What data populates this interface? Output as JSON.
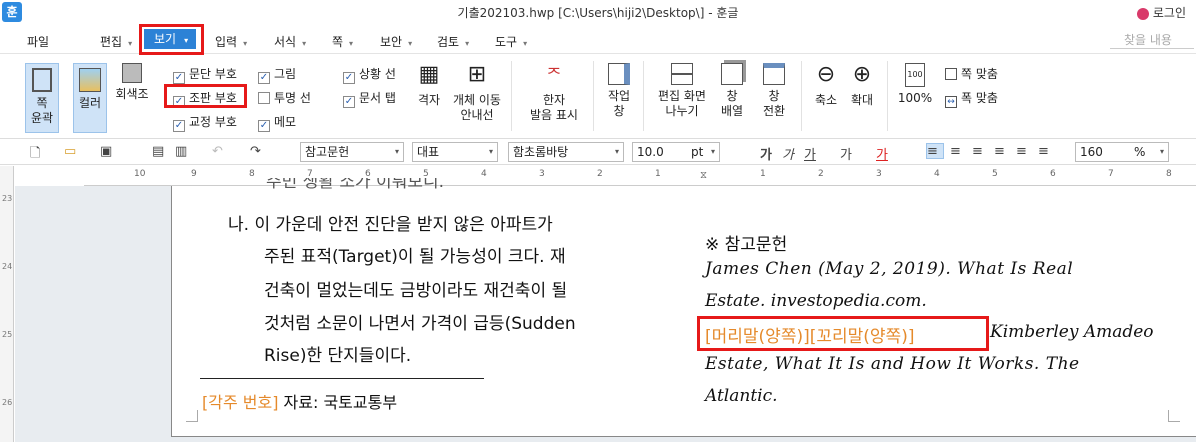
{
  "title": "기출202103.hwp [C:\\Users\\hiji2\\Desktop\\] - 훈글",
  "app_icon": "훈",
  "login": "로그인",
  "menu": {
    "items": [
      "파일",
      "편집",
      "보기",
      "입력",
      "서식",
      "쪽",
      "보안",
      "검토",
      "도구"
    ],
    "find": "찾을 내용"
  },
  "ribbon": {
    "outline": "쪽\n윤곽",
    "color": "컬러",
    "gray": "회색조",
    "checks": [
      {
        "label": "문단 부호",
        "checked": true
      },
      {
        "label": "조판 부호",
        "checked": true
      },
      {
        "label": "교정 부호",
        "checked": true
      },
      {
        "label": "그림",
        "checked": true
      },
      {
        "label": "투명 선",
        "checked": false
      },
      {
        "label": "메모",
        "checked": true
      },
      {
        "label": "상황 선",
        "checked": true
      },
      {
        "label": "문서 탭",
        "checked": true
      }
    ],
    "grid": "격자",
    "obj_move": "개체 이동\n안내선",
    "hanja": "한자\n발음 표시",
    "workwin": "작업\n창",
    "split": "편집 화면\n나누기",
    "arrange": "창\n배열",
    "switch": "창\n전환",
    "zoomout": "축소",
    "zoomin": "확대",
    "p100": "100%",
    "fit1": "쪽 맞춤",
    "fit2": "폭 맞춤"
  },
  "format": {
    "style": "참고문헌",
    "lang": "대표",
    "font": "함초롬바탕",
    "size": "10.0",
    "unit": "pt",
    "zoom": "160",
    "zoom_unit": "%"
  },
  "ruler": {
    "h": [
      "10",
      "9",
      "8",
      "7",
      "6",
      "5",
      "4",
      "3",
      "2",
      "1",
      "1",
      "2",
      "3",
      "4",
      "5",
      "6",
      "7",
      "8",
      "9"
    ],
    "v": [
      "23",
      "24",
      "25",
      "26"
    ]
  },
  "doc": {
    "left": [
      "주민 생활 소가 이뤄보니.",
      "나. 이 가운데 안전 진단을 받지 않은 아파트가",
      "주된 표적(Target)이 될 가능성이 크다. 재",
      "건축이 멀었는데도 금방이라도 재건축이 될",
      "것처럼 소문이 나면서 가격이 급등(Sudden",
      "Rise)한 단지들이다."
    ],
    "footnote_num": "[각주 번호]",
    "footnote_text": "자료: 국토교통부",
    "right_heading": "※ 참고문헌",
    "right_lines": [
      "James Chen (May 2, 2019). What Is Real",
      "Estate. investopedia.com.",
      "Kimberley Amadeo",
      "Estate, What It Is and How It Works. The",
      "Atlantic."
    ],
    "header_footer": "[머리말(양쪽)][꼬리말(양쪽)]"
  },
  "colors": {
    "accent": "#2c82d6",
    "highlight": "#e61919",
    "code_text": "#e58a2b"
  }
}
